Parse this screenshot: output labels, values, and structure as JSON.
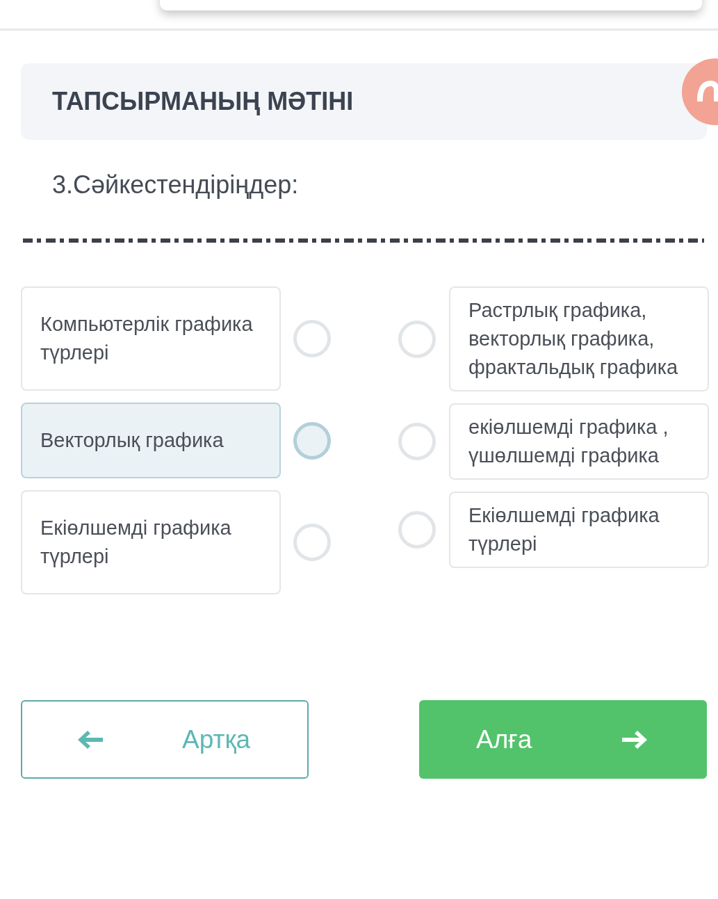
{
  "header": {
    "title": "ТАПСЫРМАНЫҢ МӘТІНІ"
  },
  "question": "3.Сәйкестендіріңдер:",
  "left_items": [
    {
      "text": "Компьютерлік графика түрлері",
      "selected": false
    },
    {
      "text": "Векторлық графика",
      "selected": true
    },
    {
      "text": "Екіөлшемді графика түрлері",
      "selected": false
    }
  ],
  "right_items": [
    {
      "text": "Растрлық графика, векторлық графика, фрактальдық графика",
      "selected": false
    },
    {
      "text": "екіөлшемді графика , үшөлшемді графика",
      "selected": false
    },
    {
      "text": "Екіөлшемді графика түрлері",
      "selected": false
    }
  ],
  "buttons": [
    {
      "kind": "back",
      "label": "Артқа"
    },
    {
      "kind": "next",
      "label": "Алға"
    }
  ]
}
